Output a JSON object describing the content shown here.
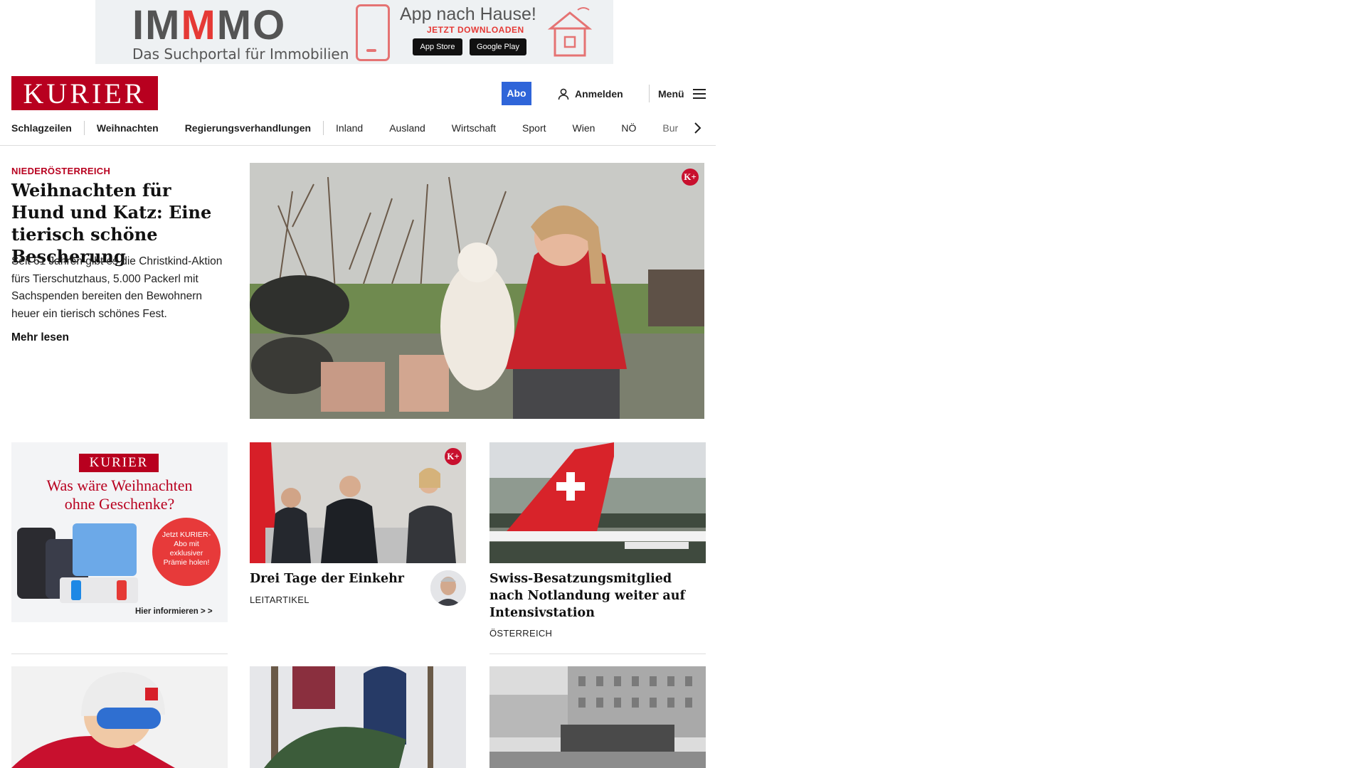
{
  "ad_banner": {
    "logo_prefix": "IM",
    "logo_highlight": "M",
    "logo_suffix": "MO",
    "tagline": "Das Suchportal für Immobilien",
    "headline": "App nach Hause!",
    "cta": "JETZT DOWNLOADEN",
    "store_apple": "App Store",
    "store_google": "Google Play"
  },
  "header": {
    "logo": "KURIER",
    "abo_label": "Abo",
    "login_label": "Anmelden",
    "menu_label": "Menü"
  },
  "nav": {
    "items": [
      "Schlagzeilen",
      "Weihnachten",
      "Regierungsverhandlungen",
      "Inland",
      "Ausland",
      "Wirtschaft",
      "Sport",
      "Wien",
      "NÖ",
      "Bur"
    ]
  },
  "lead": {
    "kicker": "NIEDERÖSTERREICH",
    "title": "Weihnachten für Hund und Katz: Eine tierisch schöne Bescherung",
    "teaser": "Seit 61 Jahren gibt es die Christkind-Aktion fürs Tierschutzhaus, 5.000 Packerl mit Sachspenden bereiten den Bewohnern heuer ein tierisch schönes Fest.",
    "more_label": "Mehr lesen",
    "badge": "K+"
  },
  "promo": {
    "brand": "KURIER",
    "headline": "Was wäre Weihnachten ohne Geschenke?",
    "bubble": "Jetzt KURIER-Abo mit exklusiver Prämie holen!",
    "cta": "Hier informieren > >"
  },
  "cards": [
    {
      "title": "Drei Tage der Einkehr",
      "tag": "LEITARTIKEL",
      "badge": "K+"
    },
    {
      "title": "Swiss-Besatzungsmitglied nach Notlandung weiter auf Intensivstation",
      "tag": "ÖSTERREICH"
    }
  ],
  "colors": {
    "brand_red": "#b8001f",
    "abo_blue": "#2f65d9",
    "immo_red": "#e53935"
  }
}
